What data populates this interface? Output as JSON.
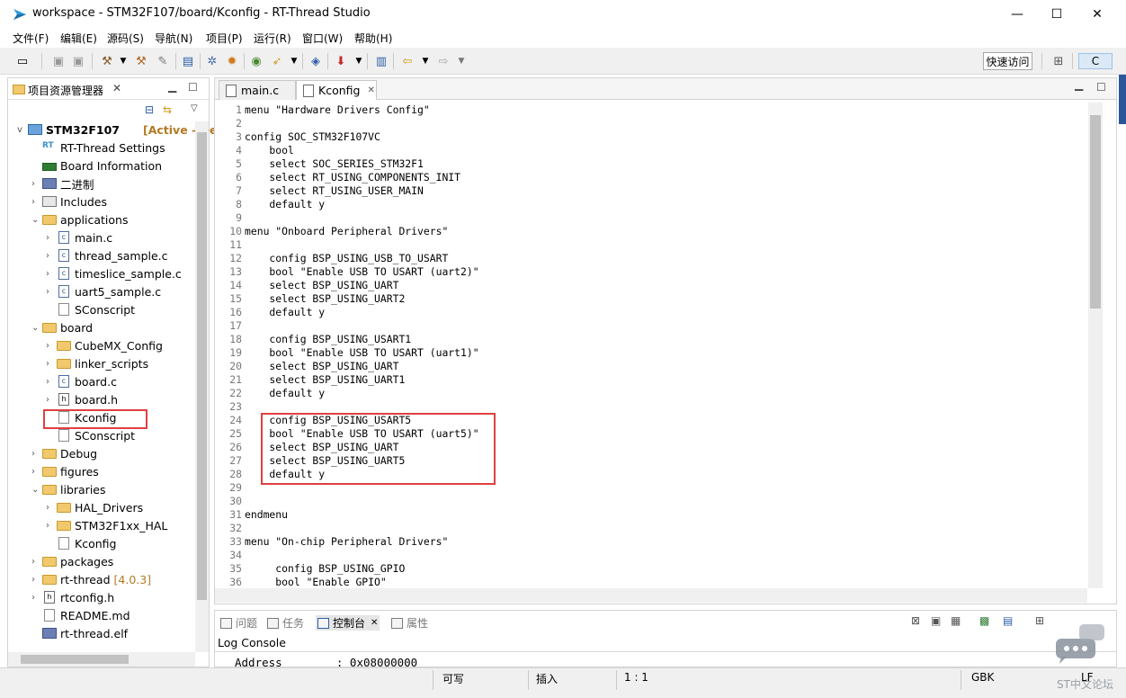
{
  "window": {
    "title": "workspace - STM32F107/board/Kconfig - RT-Thread Studio",
    "controls": [
      "—",
      "☐",
      "✕"
    ]
  },
  "menu": [
    "文件(F)",
    "编辑(E)",
    "源码(S)",
    "导航(N)",
    "项目(P)",
    "运行(R)",
    "窗口(W)",
    "帮助(H)"
  ],
  "toolbar": {
    "quick_access": "快速访问",
    "perspective": "C"
  },
  "explorer": {
    "title": "项目资源管理器",
    "project": {
      "name": "STM32F107",
      "status": "[Active - De"
    },
    "items": [
      {
        "label": "RT-Thread Settings",
        "icon": "settings",
        "indent": 1,
        "arrow": ""
      },
      {
        "label": "Board Information",
        "icon": "board",
        "indent": 1,
        "arrow": ""
      },
      {
        "label": "二进制",
        "icon": "bin",
        "indent": 1,
        "arrow": ">"
      },
      {
        "label": "Includes",
        "icon": "inc",
        "indent": 1,
        "arrow": ">"
      },
      {
        "label": "applications",
        "icon": "folder",
        "indent": 1,
        "arrow": "v"
      },
      {
        "label": "main.c",
        "icon": "cfile",
        "indent": 2,
        "arrow": ">"
      },
      {
        "label": "thread_sample.c",
        "icon": "cfile",
        "indent": 2,
        "arrow": ">"
      },
      {
        "label": "timeslice_sample.c",
        "icon": "cfile",
        "indent": 2,
        "arrow": ">"
      },
      {
        "label": "uart5_sample.c",
        "icon": "cfile",
        "indent": 2,
        "arrow": ">"
      },
      {
        "label": "SConscript",
        "icon": "file",
        "indent": 2,
        "arrow": ""
      },
      {
        "label": "board",
        "icon": "folder",
        "indent": 1,
        "arrow": "v"
      },
      {
        "label": "CubeMX_Config",
        "icon": "folder",
        "indent": 2,
        "arrow": ">"
      },
      {
        "label": "linker_scripts",
        "icon": "folder",
        "indent": 2,
        "arrow": ">"
      },
      {
        "label": "board.c",
        "icon": "cfile",
        "indent": 2,
        "arrow": ">"
      },
      {
        "label": "board.h",
        "icon": "hfile",
        "indent": 2,
        "arrow": ">"
      },
      {
        "label": "Kconfig",
        "icon": "file",
        "indent": 2,
        "arrow": "",
        "selected": true
      },
      {
        "label": "SConscript",
        "icon": "file",
        "indent": 2,
        "arrow": ""
      },
      {
        "label": "Debug",
        "icon": "folder",
        "indent": 1,
        "arrow": ">"
      },
      {
        "label": "figures",
        "icon": "folder",
        "indent": 1,
        "arrow": ">"
      },
      {
        "label": "libraries",
        "icon": "folder",
        "indent": 1,
        "arrow": "v"
      },
      {
        "label": "HAL_Drivers",
        "icon": "folder",
        "indent": 2,
        "arrow": ">"
      },
      {
        "label": "STM32F1xx_HAL",
        "icon": "folder",
        "indent": 2,
        "arrow": ">"
      },
      {
        "label": "Kconfig",
        "icon": "file",
        "indent": 2,
        "arrow": ""
      },
      {
        "label": "packages",
        "icon": "folder",
        "indent": 1,
        "arrow": ">"
      },
      {
        "label": "rt-thread",
        "icon": "folder",
        "indent": 1,
        "arrow": ">",
        "suffix": "[4.0.3]"
      },
      {
        "label": "rtconfig.h",
        "icon": "hfile",
        "indent": 1,
        "arrow": ">"
      },
      {
        "label": "README.md",
        "icon": "file",
        "indent": 1,
        "arrow": ""
      },
      {
        "label": "rt-thread.elf",
        "icon": "bin",
        "indent": 1,
        "arrow": ""
      }
    ]
  },
  "editor": {
    "tabs": [
      {
        "label": "main.c",
        "active": false
      },
      {
        "label": "Kconfig",
        "active": true
      }
    ],
    "lines": [
      "menu \"Hardware Drivers Config\"",
      "",
      "config SOC_STM32F107VC",
      "    bool",
      "    select SOC_SERIES_STM32F1",
      "    select RT_USING_COMPONENTS_INIT",
      "    select RT_USING_USER_MAIN",
      "    default y",
      "",
      "menu \"Onboard Peripheral Drivers\"",
      "",
      "    config BSP_USING_USB_TO_USART",
      "    bool \"Enable USB TO USART (uart2)\"",
      "    select BSP_USING_UART",
      "    select BSP_USING_UART2",
      "    default y",
      "",
      "    config BSP_USING_USART1",
      "    bool \"Enable USB TO USART (uart1)\"",
      "    select BSP_USING_UART",
      "    select BSP_USING_UART1",
      "    default y",
      "",
      "    config BSP_USING_USART5",
      "    bool \"Enable USB TO USART (uart5)\"",
      "    select BSP_USING_UART",
      "    select BSP_USING_UART5",
      "    default y",
      "",
      "",
      "endmenu",
      "",
      "menu \"On-chip Peripheral Drivers\"",
      "",
      "     config BSP_USING_GPIO",
      "     bool \"Enable GPIO\""
    ]
  },
  "console": {
    "tabs": [
      "问题",
      "任务",
      "控制台",
      "属性"
    ],
    "active_tab": "控制台",
    "title": "Log Console",
    "text": "Address        : 0x08000000"
  },
  "statusbar": {
    "writable": "可写",
    "insert": "插入",
    "position": "1 : 1",
    "encoding": "GBK",
    "eol": "LF"
  },
  "watermark": "ST中文论坛"
}
